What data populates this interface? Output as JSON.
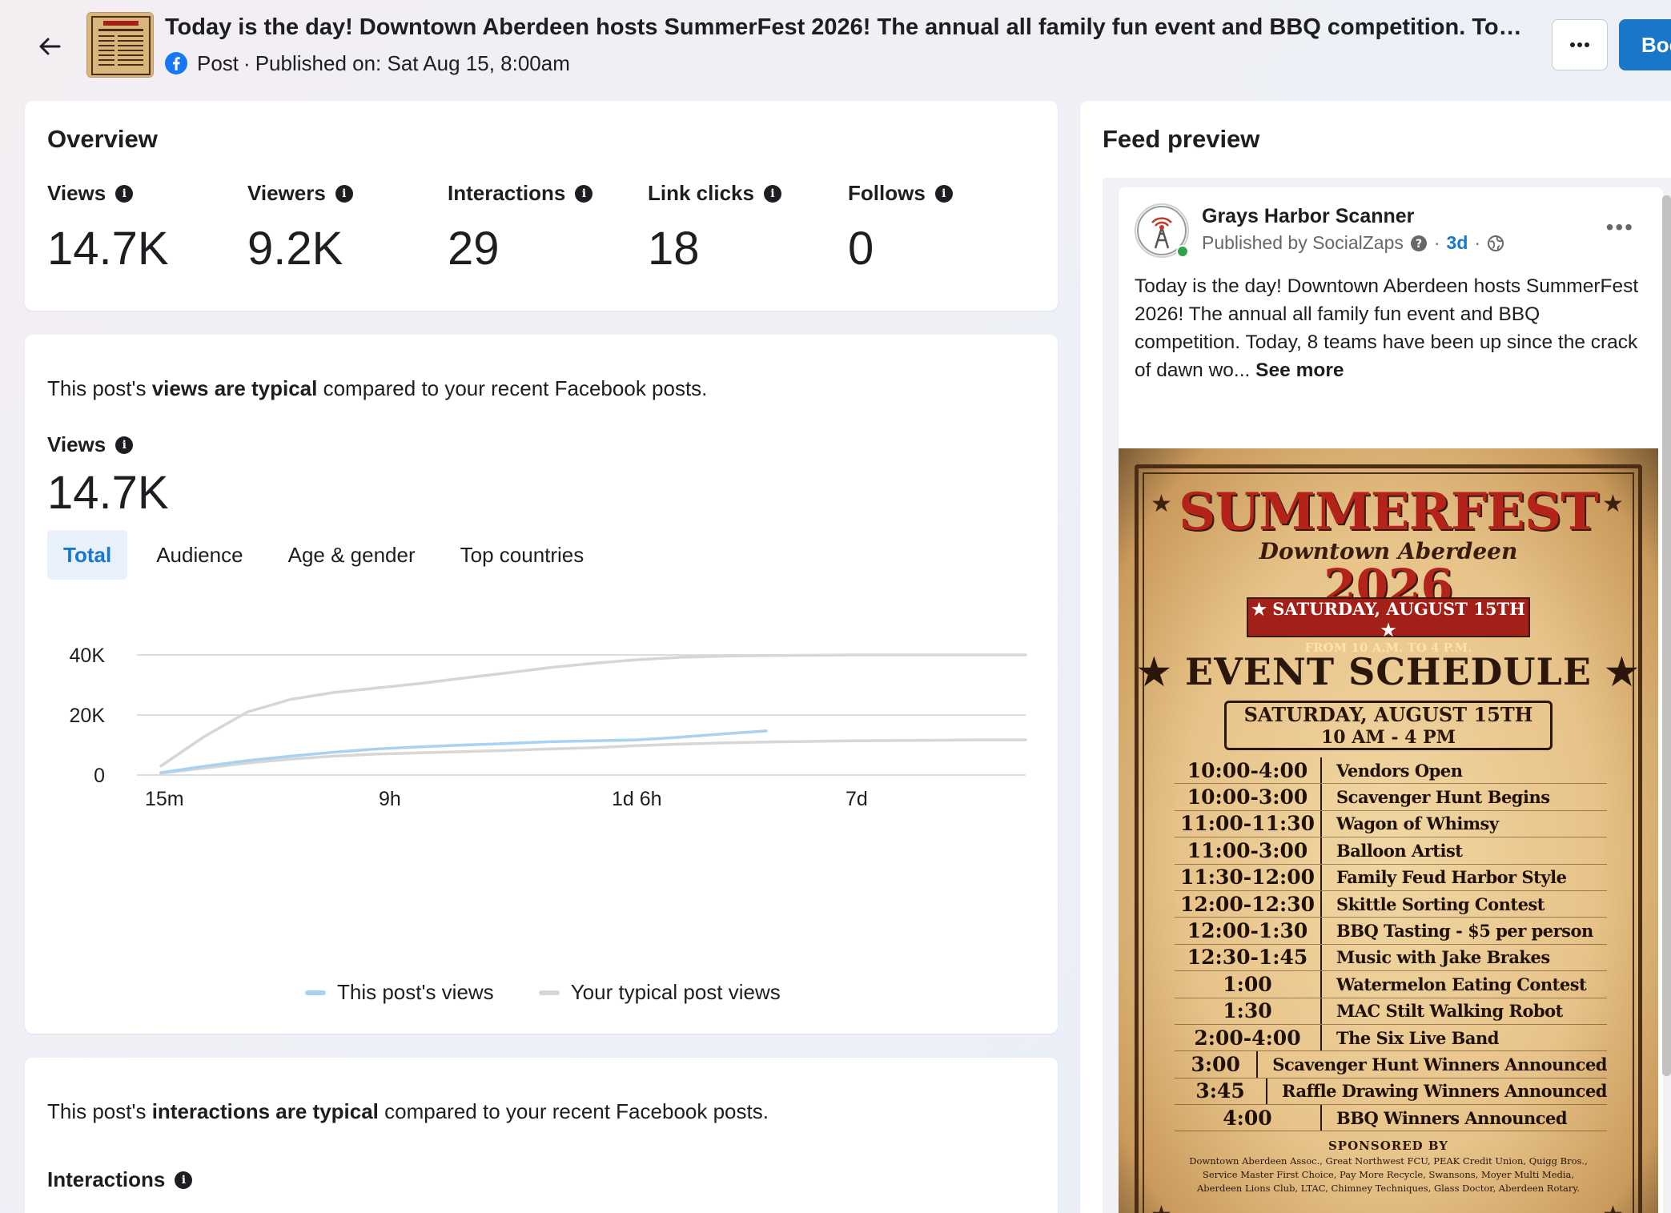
{
  "header": {
    "title": "Today is the day! Downtown Aberdeen hosts SummerFest 2026! The annual all family fun event and BBQ competition. Today, 8 te...",
    "post_type": "Post",
    "published": "Published on: Sat Aug 15, 8:00am",
    "separator": "·",
    "more_label": "···",
    "boost_label": "Boost"
  },
  "overview": {
    "title": "Overview",
    "metrics": [
      {
        "label": "Views",
        "value": "14.7K"
      },
      {
        "label": "Viewers",
        "value": "9.2K"
      },
      {
        "label": "Interactions",
        "value": "29"
      },
      {
        "label": "Link clicks",
        "value": "18"
      },
      {
        "label": "Follows",
        "value": "0"
      }
    ]
  },
  "views_card": {
    "sentence_prefix": "This post's ",
    "sentence_bold": "views are typical",
    "sentence_suffix": " compared to your recent Facebook posts.",
    "label": "Views",
    "value": "14.7K",
    "tabs": [
      "Total",
      "Audience",
      "Age & gender",
      "Top countries"
    ],
    "active_tab": "Total"
  },
  "chart_data": {
    "type": "line",
    "x_ticks": [
      "15m",
      "9h",
      "1d 6h",
      "7d"
    ],
    "y_ticks": [
      "0",
      "20K",
      "40K"
    ],
    "ylim": [
      0,
      40000
    ],
    "grid": true,
    "legend_position": "bottom",
    "series": [
      {
        "name": "This post's views",
        "color": "#a8d2f2",
        "x": [
          0.0,
          0.05,
          0.1,
          0.15,
          0.2,
          0.25,
          0.3,
          0.35,
          0.4,
          0.45,
          0.5,
          0.55,
          0.6,
          0.65,
          0.7
        ],
        "values": [
          800,
          2900,
          4800,
          6300,
          7600,
          8700,
          9400,
          10000,
          10500,
          11100,
          11400,
          11700,
          12600,
          13700,
          14700
        ]
      },
      {
        "name": "Your typical post views",
        "color": "#d6d6d6",
        "x": [
          0.0,
          0.05,
          0.1,
          0.15,
          0.2,
          0.25,
          0.3,
          0.35,
          0.4,
          0.45,
          0.5,
          0.55,
          0.6,
          0.65,
          0.7,
          0.75,
          0.8,
          0.85,
          0.9,
          0.95,
          1.0
        ],
        "values": [
          600,
          2300,
          4000,
          5300,
          6300,
          7000,
          7400,
          7800,
          8200,
          8700,
          9100,
          9800,
          10300,
          10700,
          11000,
          11200,
          11400,
          11500,
          11600,
          11700,
          11700
        ]
      },
      {
        "name": "",
        "color": "#d6d6d6",
        "x": [
          0.0,
          0.05,
          0.1,
          0.15,
          0.2,
          0.25,
          0.3,
          0.35,
          0.4,
          0.45,
          0.5,
          0.55,
          0.6,
          0.65,
          0.7,
          0.75,
          0.8,
          0.85,
          0.9,
          0.95,
          1.0
        ],
        "values": [
          3000,
          12800,
          21000,
          25200,
          27500,
          29000,
          30500,
          32300,
          34000,
          35800,
          37200,
          38400,
          39200,
          39600,
          39800,
          39900,
          40000,
          40000,
          40000,
          40000,
          40000
        ]
      }
    ]
  },
  "interactions_card": {
    "sentence_prefix": "This post's ",
    "sentence_bold": "interactions are typical",
    "sentence_suffix": " compared to your recent Facebook posts.",
    "label": "Interactions",
    "value": "29"
  },
  "feed_preview": {
    "title": "Feed preview",
    "page_name": "Grays Harbor Scanner",
    "published_by": "Published by SocialZaps",
    "time": "3d",
    "dot": "·",
    "more": "•••",
    "text": "Today is the day!  Downtown Aberdeen hosts SummerFest 2026! The annual all family fun event and BBQ competition.  Today, 8 teams have been up since the crack of dawn wo...",
    "see_more": "See more",
    "poster": {
      "title": "SUMMERFEST",
      "subtitle": "Downtown      Aberdeen",
      "year": "2026",
      "banner_date": "★ SATURDAY, AUGUST 15TH ★",
      "banner_time": "FROM 10 A.M. TO 4 P.M.",
      "schedule_title": "★ EVENT SCHEDULE ★",
      "box_line1": "SATURDAY, AUGUST 15TH",
      "box_line2": "10 AM - 4 PM",
      "schedule": [
        {
          "time": "10:00-4:00",
          "event": "Vendors Open"
        },
        {
          "time": "10:00-3:00",
          "event": "Scavenger Hunt Begins"
        },
        {
          "time": "11:00-11:30",
          "event": "Wagon of Whimsy"
        },
        {
          "time": "11:00-3:00",
          "event": "Balloon Artist"
        },
        {
          "time": "11:30-12:00",
          "event": "Family Feud Harbor Style"
        },
        {
          "time": "12:00-12:30",
          "event": "Skittle Sorting Contest"
        },
        {
          "time": "12:00-1:30",
          "event": "BBQ Tasting - $5 per person"
        },
        {
          "time": "12:30-1:45",
          "event": "Music with Jake Brakes"
        },
        {
          "time": "1:00",
          "event": "Watermelon Eating Contest"
        },
        {
          "time": "1:30",
          "event": "MAC Stilt Walking Robot"
        },
        {
          "time": "2:00-4:00",
          "event": "The Six Live Band"
        },
        {
          "time": "3:00",
          "event": "Scavenger Hunt Winners Announced"
        },
        {
          "time": "3:45",
          "event": "Raffle Drawing Winners Announced"
        },
        {
          "time": "4:00",
          "event": "BBQ Winners Announced"
        }
      ],
      "sponsored_by": "SPONSORED BY",
      "sponsors": "Downtown Aberdeen Assoc., Great Northwest FCU, PEAK Credit Union, Quigg Bros., Service Master First Choice, Pay More Recycle, Swansons, Moyer Multi Media, Aberdeen Lions Club, LTAC, Chimney Techniques, Glass Doctor, Aberdeen Rotary."
    }
  }
}
